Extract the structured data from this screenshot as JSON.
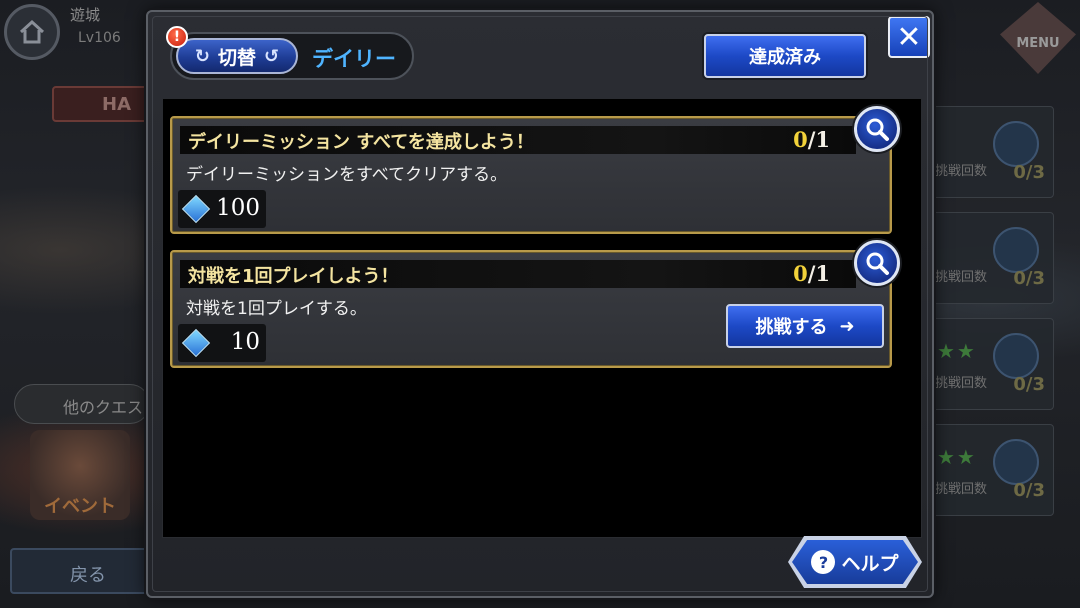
{
  "background": {
    "area_title": "遊城",
    "level": "Lv106",
    "ha_label": "HA",
    "other_quest_label": "他のクエス",
    "event_label": "イベント",
    "back_label": "戻る",
    "menu_label": "MENU",
    "side_cards": [
      {
        "label": "挑戦回数",
        "count": "0/3"
      },
      {
        "label": "挑戦回数",
        "count": "0/3"
      },
      {
        "label": "挑戦回数",
        "count": "0/3"
      },
      {
        "label": "挑戦回数",
        "count": "0/3"
      }
    ]
  },
  "dialog": {
    "switch_label": "切替",
    "current_tab": "デイリー",
    "completed_label": "達成済み",
    "close_glyph": "✕",
    "help_label": "ヘルプ",
    "help_glyph": "?",
    "alert_glyph": "!"
  },
  "missions": [
    {
      "title": "デイリーミッション すべてを達成しよう！",
      "current": "0",
      "total": "/1",
      "description": "デイリーミッションをすべてクリアする。",
      "reward_icon": "crystal-icon",
      "reward_amount": "100"
    },
    {
      "title": "対戦を1回プレイしよう！",
      "current": "0",
      "total": "/1",
      "description": "対戦を1回プレイする。",
      "reward_icon": "crystal-icon",
      "reward_amount": "10",
      "challenge_label": "挑戦する",
      "challenge_arrow": "➜"
    }
  ],
  "colors": {
    "accent_blue": "#1d49c6",
    "title_gold": "#f4e4a0",
    "progress_yellow": "#f2d23a",
    "tab_label_blue": "#4fb4ff"
  }
}
